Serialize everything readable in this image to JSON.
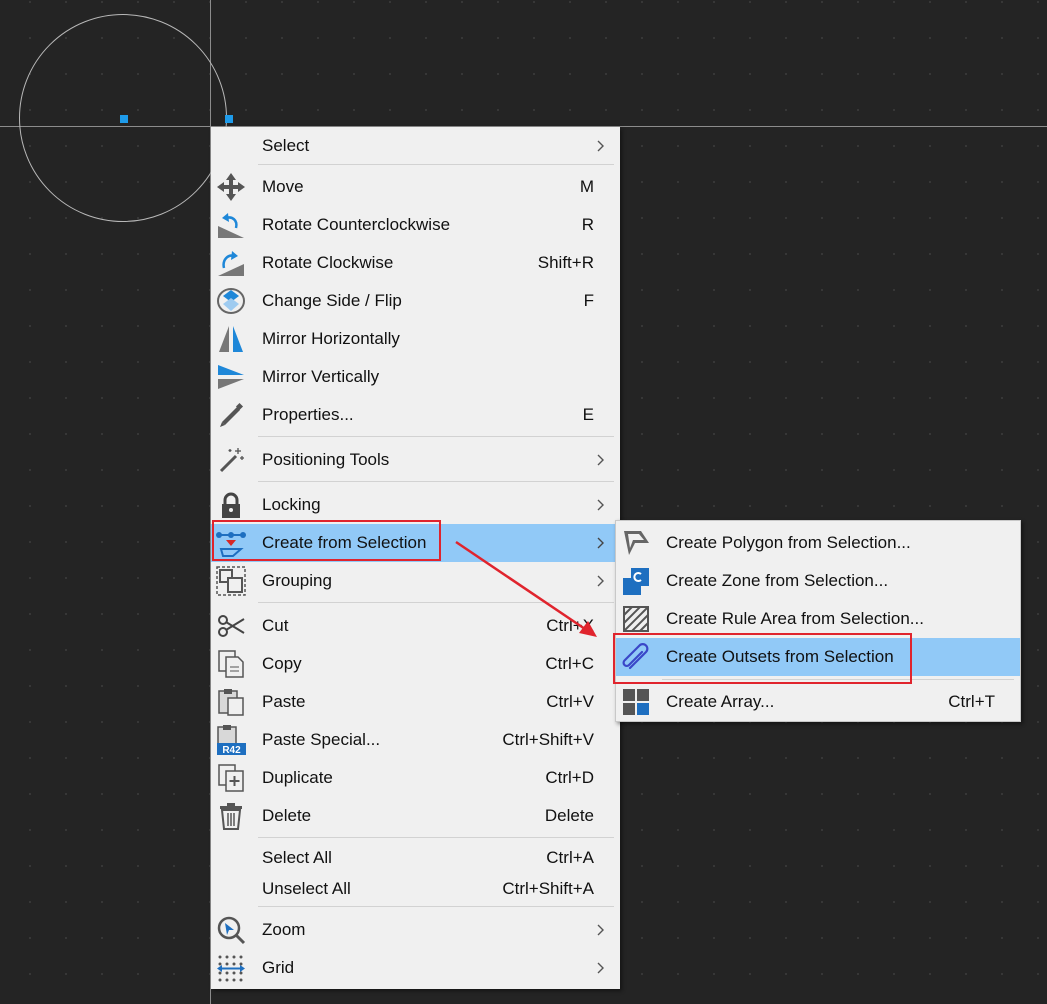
{
  "context_menu": {
    "items": [
      {
        "label": "Select",
        "shortcut": "",
        "submenu": true
      },
      {
        "label": "Move",
        "shortcut": "M"
      },
      {
        "label": "Rotate Counterclockwise",
        "shortcut": "R"
      },
      {
        "label": "Rotate Clockwise",
        "shortcut": "Shift+R"
      },
      {
        "label": "Change Side / Flip",
        "shortcut": "F"
      },
      {
        "label": "Mirror Horizontally",
        "shortcut": ""
      },
      {
        "label": "Mirror Vertically",
        "shortcut": ""
      },
      {
        "label": "Properties...",
        "shortcut": "E"
      },
      {
        "label": "Positioning Tools",
        "shortcut": "",
        "submenu": true
      },
      {
        "label": "Locking",
        "shortcut": "",
        "submenu": true
      },
      {
        "label": "Create from Selection",
        "shortcut": "",
        "submenu": true,
        "highlighted": true
      },
      {
        "label": "Grouping",
        "shortcut": "",
        "submenu": true
      },
      {
        "label": "Cut",
        "shortcut": "Ctrl+X"
      },
      {
        "label": "Copy",
        "shortcut": "Ctrl+C"
      },
      {
        "label": "Paste",
        "shortcut": "Ctrl+V"
      },
      {
        "label": "Paste Special...",
        "shortcut": "Ctrl+Shift+V"
      },
      {
        "label": "Duplicate",
        "shortcut": "Ctrl+D"
      },
      {
        "label": "Delete",
        "shortcut": "Delete"
      },
      {
        "label": "Select All",
        "shortcut": "Ctrl+A"
      },
      {
        "label": "Unselect All",
        "shortcut": "Ctrl+Shift+A"
      },
      {
        "label": "Zoom",
        "shortcut": "",
        "submenu": true
      },
      {
        "label": "Grid",
        "shortcut": "",
        "submenu": true
      }
    ]
  },
  "submenu": {
    "items": [
      {
        "label": "Create Polygon from Selection...",
        "shortcut": ""
      },
      {
        "label": "Create Zone from Selection...",
        "shortcut": ""
      },
      {
        "label": "Create Rule Area from Selection...",
        "shortcut": ""
      },
      {
        "label": "Create Outsets from Selection",
        "shortcut": "",
        "highlighted": true
      },
      {
        "label": "Create Array...",
        "shortcut": "Ctrl+T"
      }
    ]
  },
  "icons": {
    "paste_special_badge": "R42"
  },
  "colors": {
    "canvas": "#242424",
    "menu_bg": "#f0f0f0",
    "highlight": "#91c9f7",
    "annotation_red": "#e0242d",
    "anchor_blue": "#1e9bea"
  }
}
